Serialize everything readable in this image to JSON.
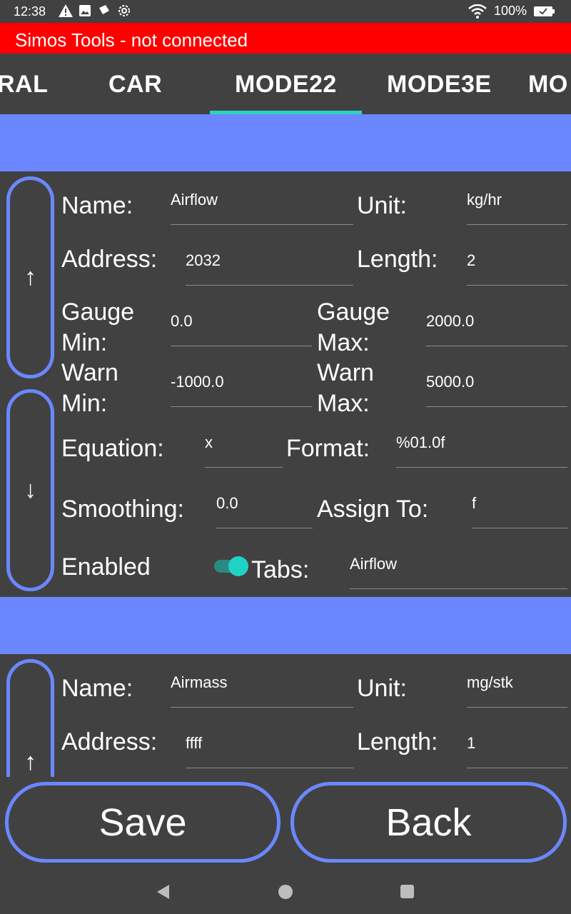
{
  "status_bar": {
    "time": "12:38",
    "battery_percent": "100%",
    "icons": [
      "warning-icon",
      "image-icon",
      "dropbox-icon",
      "settings-icon",
      "wifi-icon",
      "battery-icon"
    ]
  },
  "title_bar": {
    "text": "Simos Tools - not connected",
    "color": "#ff0000"
  },
  "tabs": [
    {
      "label": "RAL"
    },
    {
      "label": "CAR"
    },
    {
      "label": "MODE22",
      "selected": true
    },
    {
      "label": "MODE3E"
    },
    {
      "label": "MO"
    }
  ],
  "labels": {
    "name": "Name:",
    "unit": "Unit:",
    "address": "Address:",
    "length": "Length:",
    "gauge_min_1": "Gauge",
    "gauge_min_2": "Min:",
    "gauge_max_1": "Gauge",
    "gauge_max_2": "Max:",
    "warn_min_1": "Warn",
    "warn_min_2": "Min:",
    "warn_max_1": "Warn",
    "warn_max_2": "Max:",
    "equation": "Equation:",
    "format": "Format:",
    "smoothing": "Smoothing:",
    "assign_to": "Assign To:",
    "enabled": "Enabled",
    "tabs": "Tabs:"
  },
  "pids": [
    {
      "name": "Airflow",
      "unit": "kg/hr",
      "address": "2032",
      "length": "2",
      "gauge_min": "0.0",
      "gauge_max": "2000.0",
      "warn_min": "-1000.0",
      "warn_max": "5000.0",
      "equation": "x",
      "format": "%01.0f",
      "smoothing": "0.0",
      "assign_to": "f",
      "enabled": true,
      "tabs": "Airflow"
    },
    {
      "name": "Airmass",
      "unit": "mg/stk",
      "address": "ffff",
      "length": "1"
    }
  ],
  "arrows": {
    "up": "↑",
    "down": "↓"
  },
  "buttons": {
    "save": "Save",
    "back": "Back"
  },
  "colors": {
    "accent": "#6b87ff",
    "tab_indicator": "#2ed0c4",
    "background": "#414141",
    "toggle_on": "#1fd3c4"
  }
}
